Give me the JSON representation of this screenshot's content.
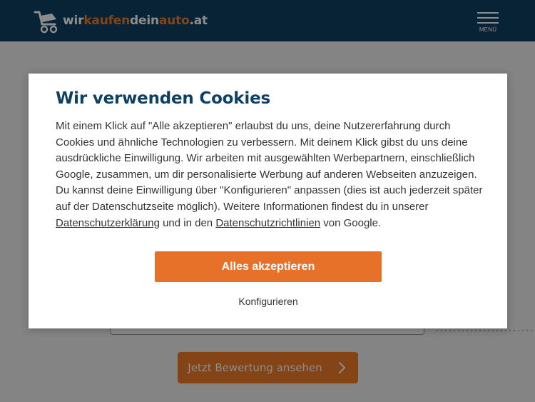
{
  "header": {
    "logo": {
      "part1": "wir",
      "part2": "kaufen",
      "part3": "dein",
      "part4": "auto",
      "part5": ".at"
    },
    "menu_label": "MENÜ"
  },
  "background": {
    "cta_label": "Jetzt Bewertung ansehen"
  },
  "cookie_modal": {
    "title": "Wir verwenden Cookies",
    "body_text": "Mit einem Klick auf \"Alle akzeptieren\" erlaubst du uns, deine Nutzererfahrung durch Cookies und ähnliche Technologien zu verbessern. Mit deinem Klick gibst du uns deine ausdrückliche Einwilligung. Wir arbeiten mit ausgewählten Werbepartnern, einschließlich Google, zusammen, um dir personalisierte Werbung auf anderen Webseiten anzuzeigen. Du kannst deine Einwilligung über \"Konfigurieren\" anpassen (dies ist auch jederzeit später auf der Datenschutzseite möglich). Weitere Informationen findest du in unserer ",
    "privacy_link": "Datenschutzerklärung",
    "mid_text": " und in den ",
    "google_link": "Datenschutzrichtlinien",
    "end_text": " von Google.",
    "accept_button": "Alles akzeptieren",
    "configure_link": "Konfigurieren"
  },
  "colors": {
    "header_bg": "#0f4062",
    "accent_orange": "#f07d28",
    "title_blue": "#0f4062"
  },
  "icons": {
    "logo": "car-trolley-logo-icon",
    "menu": "hamburger-menu-icon",
    "cta_arrow": "chevron-right-icon"
  }
}
